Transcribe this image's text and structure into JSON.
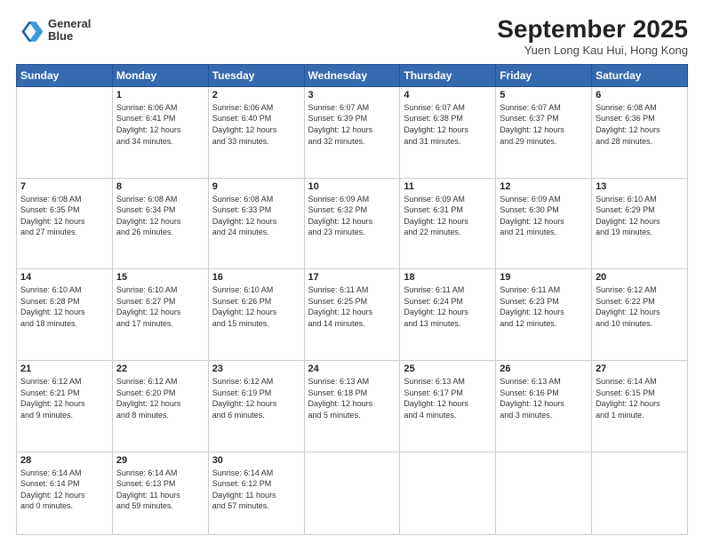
{
  "header": {
    "logo_line1": "General",
    "logo_line2": "Blue",
    "month_title": "September 2025",
    "location": "Yuen Long Kau Hui, Hong Kong"
  },
  "days_of_week": [
    "Sunday",
    "Monday",
    "Tuesday",
    "Wednesday",
    "Thursday",
    "Friday",
    "Saturday"
  ],
  "weeks": [
    [
      {
        "num": "",
        "info": ""
      },
      {
        "num": "1",
        "info": "Sunrise: 6:06 AM\nSunset: 6:41 PM\nDaylight: 12 hours\nand 34 minutes."
      },
      {
        "num": "2",
        "info": "Sunrise: 6:06 AM\nSunset: 6:40 PM\nDaylight: 12 hours\nand 33 minutes."
      },
      {
        "num": "3",
        "info": "Sunrise: 6:07 AM\nSunset: 6:39 PM\nDaylight: 12 hours\nand 32 minutes."
      },
      {
        "num": "4",
        "info": "Sunrise: 6:07 AM\nSunset: 6:38 PM\nDaylight: 12 hours\nand 31 minutes."
      },
      {
        "num": "5",
        "info": "Sunrise: 6:07 AM\nSunset: 6:37 PM\nDaylight: 12 hours\nand 29 minutes."
      },
      {
        "num": "6",
        "info": "Sunrise: 6:08 AM\nSunset: 6:36 PM\nDaylight: 12 hours\nand 28 minutes."
      }
    ],
    [
      {
        "num": "7",
        "info": "Sunrise: 6:08 AM\nSunset: 6:35 PM\nDaylight: 12 hours\nand 27 minutes."
      },
      {
        "num": "8",
        "info": "Sunrise: 6:08 AM\nSunset: 6:34 PM\nDaylight: 12 hours\nand 26 minutes."
      },
      {
        "num": "9",
        "info": "Sunrise: 6:08 AM\nSunset: 6:33 PM\nDaylight: 12 hours\nand 24 minutes."
      },
      {
        "num": "10",
        "info": "Sunrise: 6:09 AM\nSunset: 6:32 PM\nDaylight: 12 hours\nand 23 minutes."
      },
      {
        "num": "11",
        "info": "Sunrise: 6:09 AM\nSunset: 6:31 PM\nDaylight: 12 hours\nand 22 minutes."
      },
      {
        "num": "12",
        "info": "Sunrise: 6:09 AM\nSunset: 6:30 PM\nDaylight: 12 hours\nand 21 minutes."
      },
      {
        "num": "13",
        "info": "Sunrise: 6:10 AM\nSunset: 6:29 PM\nDaylight: 12 hours\nand 19 minutes."
      }
    ],
    [
      {
        "num": "14",
        "info": "Sunrise: 6:10 AM\nSunset: 6:28 PM\nDaylight: 12 hours\nand 18 minutes."
      },
      {
        "num": "15",
        "info": "Sunrise: 6:10 AM\nSunset: 6:27 PM\nDaylight: 12 hours\nand 17 minutes."
      },
      {
        "num": "16",
        "info": "Sunrise: 6:10 AM\nSunset: 6:26 PM\nDaylight: 12 hours\nand 15 minutes."
      },
      {
        "num": "17",
        "info": "Sunrise: 6:11 AM\nSunset: 6:25 PM\nDaylight: 12 hours\nand 14 minutes."
      },
      {
        "num": "18",
        "info": "Sunrise: 6:11 AM\nSunset: 6:24 PM\nDaylight: 12 hours\nand 13 minutes."
      },
      {
        "num": "19",
        "info": "Sunrise: 6:11 AM\nSunset: 6:23 PM\nDaylight: 12 hours\nand 12 minutes."
      },
      {
        "num": "20",
        "info": "Sunrise: 6:12 AM\nSunset: 6:22 PM\nDaylight: 12 hours\nand 10 minutes."
      }
    ],
    [
      {
        "num": "21",
        "info": "Sunrise: 6:12 AM\nSunset: 6:21 PM\nDaylight: 12 hours\nand 9 minutes."
      },
      {
        "num": "22",
        "info": "Sunrise: 6:12 AM\nSunset: 6:20 PM\nDaylight: 12 hours\nand 8 minutes."
      },
      {
        "num": "23",
        "info": "Sunrise: 6:12 AM\nSunset: 6:19 PM\nDaylight: 12 hours\nand 6 minutes."
      },
      {
        "num": "24",
        "info": "Sunrise: 6:13 AM\nSunset: 6:18 PM\nDaylight: 12 hours\nand 5 minutes."
      },
      {
        "num": "25",
        "info": "Sunrise: 6:13 AM\nSunset: 6:17 PM\nDaylight: 12 hours\nand 4 minutes."
      },
      {
        "num": "26",
        "info": "Sunrise: 6:13 AM\nSunset: 6:16 PM\nDaylight: 12 hours\nand 3 minutes."
      },
      {
        "num": "27",
        "info": "Sunrise: 6:14 AM\nSunset: 6:15 PM\nDaylight: 12 hours\nand 1 minute."
      }
    ],
    [
      {
        "num": "28",
        "info": "Sunrise: 6:14 AM\nSunset: 6:14 PM\nDaylight: 12 hours\nand 0 minutes."
      },
      {
        "num": "29",
        "info": "Sunrise: 6:14 AM\nSunset: 6:13 PM\nDaylight: 11 hours\nand 59 minutes."
      },
      {
        "num": "30",
        "info": "Sunrise: 6:14 AM\nSunset: 6:12 PM\nDaylight: 11 hours\nand 57 minutes."
      },
      {
        "num": "",
        "info": ""
      },
      {
        "num": "",
        "info": ""
      },
      {
        "num": "",
        "info": ""
      },
      {
        "num": "",
        "info": ""
      }
    ]
  ]
}
